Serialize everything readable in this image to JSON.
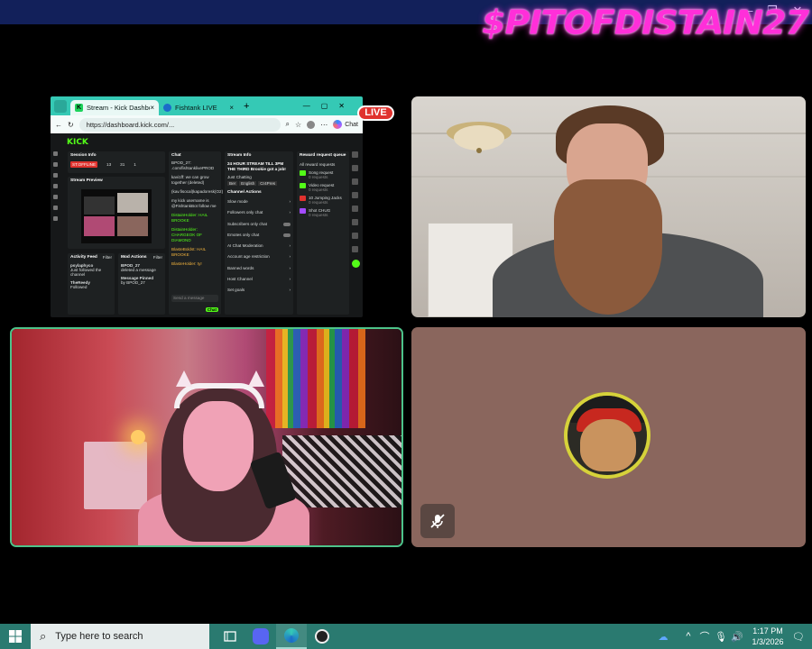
{
  "overlay": {
    "channel_name": "$PITOFDISTAIN27",
    "live_badge": "LIVE"
  },
  "window_controls": {
    "minimize": "—",
    "restore": "❐",
    "close": "✕"
  },
  "browser": {
    "tabs": [
      {
        "label": "Stream - Kick Dashboar",
        "active": true,
        "favicon": "kick-logo"
      },
      {
        "label": "Fishtank LIVE",
        "active": false,
        "favicon": "fishtank-logo"
      }
    ],
    "new_tab": "+",
    "address": "https://dashboard.kick.com/...",
    "chat_button": "Chat",
    "nav": {
      "back": "←",
      "refresh": "↻"
    }
  },
  "kick_dashboard": {
    "logo": "KICK",
    "session_info": {
      "title": "Session Info",
      "badge": "ST.OFFLINE",
      "stats": [
        "13",
        "31",
        "1"
      ]
    },
    "stream_preview": {
      "title": "Stream Preview"
    },
    "activity_feed": {
      "title": "Activity Feed",
      "filter": "Filter",
      "items": [
        {
          "user": "psylaphyco",
          "text": "Just followed the channel"
        },
        {
          "user": "TheReedy",
          "text": "Followed"
        }
      ]
    },
    "mod_actions": {
      "title": "Mod Actions",
      "filter": "Filter",
      "items": [
        {
          "user": "BPOD_27",
          "text": "deleted a message"
        },
        {
          "user": "Message Pinned",
          "text": "by BPOD_27"
        }
      ]
    },
    "chat": {
      "title": "Chat",
      "send_placeholder": "Send a message",
      "chat_button": "Chat",
      "lines": [
        "BPOD_27: .com/fishtanklivePROD",
        "kavi1ff: we can grow together (deleted)",
        "(kav.fisocal)kapadoresk(O2)",
        "my kick username is @FishtankBot follow me",
        "DistainHolder: HAIL BROOKE",
        "DistainHolder: CHARGEOK OF DIAMOND",
        "BlasteBoldst: HAIL BROOKE",
        "BlasteHolder: ty!"
      ]
    },
    "stream_info": {
      "title": "Stream Info",
      "headline": "24 HOUR STREAM TILL 3PM THE THIRD Brookie got a job!",
      "category": "Just Chatting",
      "tags": [
        "Ber",
        "English",
        "Cr4Pres"
      ]
    },
    "channel_actions": {
      "title": "Channel Actions",
      "items": [
        "Slow mode",
        "Followers only chat",
        "Subscribers only chat",
        "Emotes only chat",
        "AI Chat Moderation",
        "Account age restriction",
        "Banned words",
        "Host Channel",
        "Set goals"
      ]
    },
    "reward_queue": {
      "title": "Reward request queue",
      "all_label": "All reward requests",
      "items": [
        {
          "name": "Song request",
          "requests": "0 requests"
        },
        {
          "name": "Video request",
          "requests": "0 requests"
        },
        {
          "name": "10 Jumping Jacks",
          "requests": "0 requests"
        },
        {
          "name": "Shot CHUG",
          "requests": "0 requests"
        }
      ]
    }
  },
  "avatar_tile": {
    "mute_icon": "mic-off-icon"
  },
  "taskbar": {
    "search_placeholder": "Type here to search",
    "apps": [
      "task-view-icon",
      "discord-icon",
      "edge-icon",
      "obs-icon"
    ],
    "time": "1:17 PM",
    "date": "1/3/2026"
  },
  "colors": {
    "accent_green": "#53fc18",
    "taskbar": "#2a7a70",
    "live_red": "#e0322e",
    "overlay_pink": "#ff2fd9",
    "avatar_bg": "#8a665d"
  }
}
